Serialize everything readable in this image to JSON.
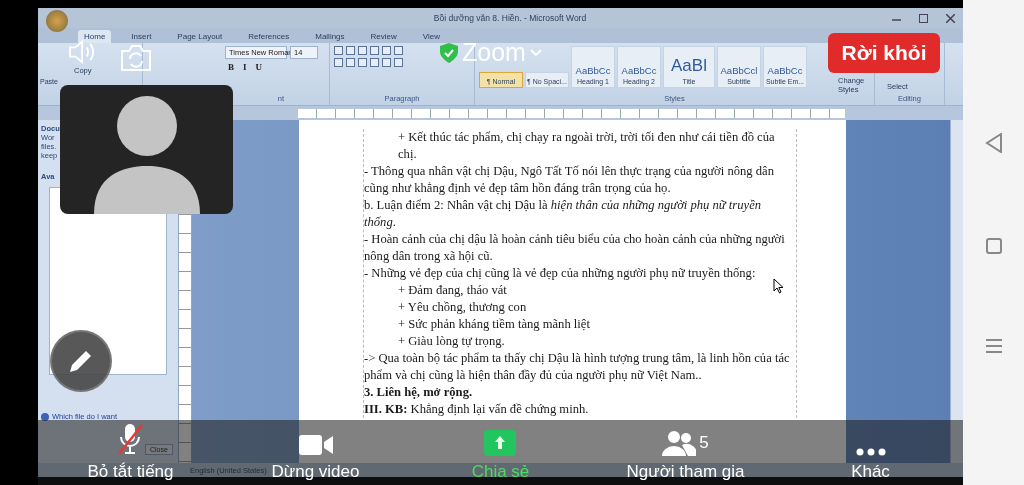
{
  "word": {
    "title": "Bồi dưỡng văn 8. Hiền. - Microsoft Word",
    "tabs": [
      {
        "label": "Home",
        "selected": true
      },
      {
        "label": "Insert",
        "selected": false
      },
      {
        "label": "Page Layout",
        "selected": false
      },
      {
        "label": "References",
        "selected": false
      },
      {
        "label": "Mailings",
        "selected": false
      },
      {
        "label": "Review",
        "selected": false
      },
      {
        "label": "View",
        "selected": false
      }
    ],
    "clipboard": {
      "paste": "Paste",
      "copy": "Copy"
    },
    "font": {
      "name": "Times New Roman",
      "size": "14",
      "buttons": [
        "B",
        "I",
        "U"
      ],
      "group_label": "nt"
    },
    "paragraph": {
      "group_label": "Paragraph"
    },
    "styles": {
      "items": [
        {
          "kind": "normal",
          "name": "¶ Normal",
          "selected": true
        },
        {
          "kind": "normal",
          "name": "¶ No Spaci...",
          "selected": false
        },
        {
          "kind": "normal",
          "sample": "AaBbCc",
          "name": "Heading 1",
          "selected": false
        },
        {
          "kind": "normal",
          "sample": "AaBbCc",
          "name": "Heading 2",
          "selected": false
        },
        {
          "kind": "large",
          "sample": "AaBl",
          "name": "Title",
          "selected": false
        },
        {
          "kind": "normal",
          "sample": "AaBbCcl",
          "name": "Subtitle",
          "selected": false
        },
        {
          "kind": "normal",
          "sample": "AaBbCc",
          "name": "Subtle Em...",
          "selected": false
        }
      ],
      "change_styles": "Change Styles",
      "group_label": "Styles"
    },
    "editing": {
      "select": "Select",
      "group_label": "Editing"
    },
    "task_pane": {
      "lines": [
        "Docu",
        "Wor",
        "files.",
        "keep"
      ],
      "heading": "Ava",
      "help_link": "Which file do I want",
      "close_button": "Close"
    },
    "document": {
      "paragraphs": [
        {
          "kind": "sub",
          "text": "+ Kết thúc tác phẩm, chị chạy ra ngoài trời, trời tối đen như cái tiền đồ của chị."
        },
        {
          "kind": "plain",
          "text": "- Thông qua nhân vật chị Dậu, Ngô Tất Tố nói lên thực trạng của người nông dân cũng như khẳng định vẻ đẹp tâm hồn đáng trân trọng của họ."
        },
        {
          "kind": "plain",
          "text": "b. Luận điểm 2: Nhân vật chị Dậu là *hiện thân của những người phụ nữ truyền thống*."
        },
        {
          "kind": "plain",
          "text": "- Hoàn cảnh của chị dậu là hoàn cảnh tiêu biểu của cho hoàn cảnh của những người nông dân trong xã hội cũ."
        },
        {
          "kind": "plain",
          "text": "- Những vẻ đẹp của chị cũng là vẻ đẹp của những người phụ nữ truyền thống:"
        },
        {
          "kind": "sub",
          "text": "+ Đảm đang, tháo vát"
        },
        {
          "kind": "sub",
          "text": "+ Yêu chồng, thương con"
        },
        {
          "kind": "sub",
          "text": "+ Sức phản kháng tiềm tàng mãnh liệt"
        },
        {
          "kind": "sub",
          "text": "+ Giàu lòng tự trọng."
        },
        {
          "kind": "plain",
          "text": "-> Qua toàn bộ tác phẩm ta thấy chị Dậu là hình tượng trung tâm, là linh hồn của tác phẩm và chị cũng là hiện thân đầy đủ của người phụ nữ Việt Nam.."
        },
        {
          "kind": "heading",
          "text": "3. Liên hệ, mở rộng."
        },
        {
          "kind": "plain",
          "text": "**III. KB:** Khẳng định lại vấn đề chứng minh."
        }
      ]
    },
    "status_bar": {
      "language": "English (United States)"
    }
  },
  "zoom": {
    "title": "Zoom",
    "leave_button": "Rời khỏi",
    "toolbar": [
      {
        "kind": "audio",
        "label": "Bỏ tắt tiếng",
        "muted": true
      },
      {
        "kind": "video",
        "label": "Dừng video"
      },
      {
        "kind": "share",
        "label": "Chia sẻ"
      },
      {
        "kind": "participants",
        "label": "Người tham gia",
        "count": "5"
      },
      {
        "kind": "more",
        "label": "Khác"
      }
    ]
  }
}
